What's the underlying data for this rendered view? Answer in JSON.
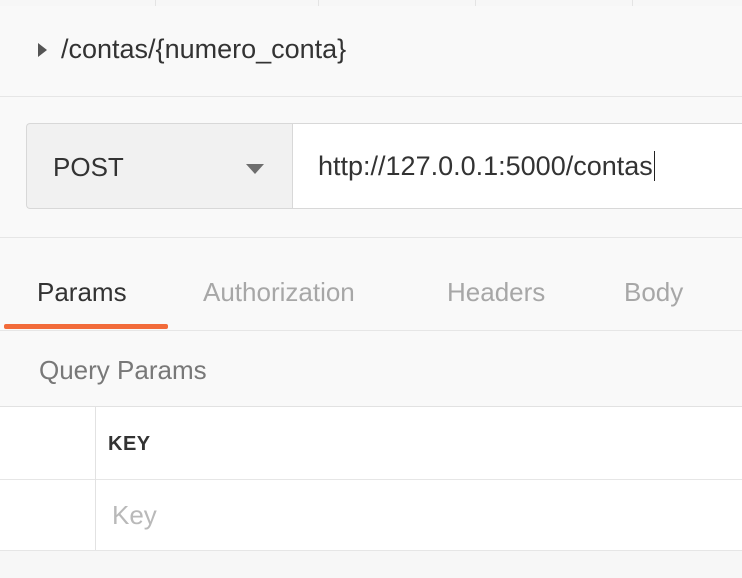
{
  "request": {
    "title": "/contas/{numero_conta}",
    "method": "POST",
    "url": "http://127.0.0.1:5000/contas"
  },
  "tabs": [
    {
      "label": "Params",
      "active": true
    },
    {
      "label": "Authorization",
      "active": false
    },
    {
      "label": "Headers",
      "active": false
    },
    {
      "label": "Body",
      "active": false
    }
  ],
  "query_params": {
    "title": "Query Params",
    "columns": [
      "KEY"
    ],
    "key_placeholder": "Key"
  },
  "colors": {
    "active_tab_indicator": "#f26b3a"
  }
}
